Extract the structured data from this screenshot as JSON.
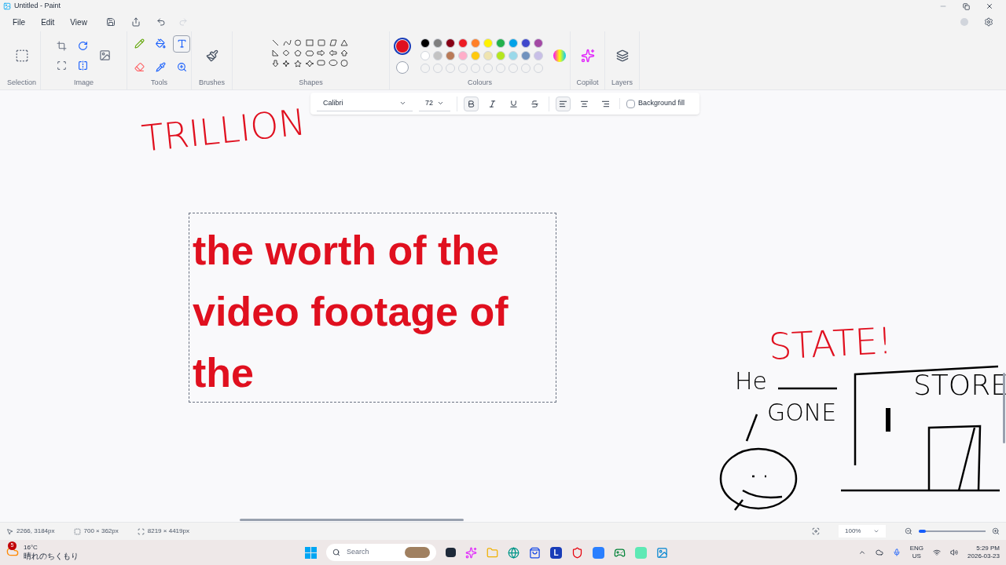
{
  "window": {
    "title": "Untitled - Paint"
  },
  "menu": [
    "File",
    "Edit",
    "View"
  ],
  "ribbon": {
    "groups": [
      {
        "kind": "selection",
        "label": "Selection"
      },
      {
        "kind": "image",
        "label": "Image"
      },
      {
        "kind": "tools",
        "label": "Tools"
      },
      {
        "kind": "brushes",
        "label": "Brushes"
      },
      {
        "kind": "shapes",
        "label": "Shapes"
      },
      {
        "kind": "colours",
        "label": "Colours"
      },
      {
        "kind": "copilot",
        "label": "Copilot"
      },
      {
        "kind": "layers",
        "label": "Layers"
      }
    ],
    "tools": [
      {
        "kind": "pencil",
        "selected": false
      },
      {
        "kind": "fill",
        "selected": false
      },
      {
        "kind": "text",
        "selected": true
      },
      {
        "kind": "eraser",
        "selected": false
      },
      {
        "kind": "picker",
        "selected": false
      },
      {
        "kind": "magnifier",
        "selected": false
      }
    ],
    "colour_1": {
      "color": "#e0101f"
    },
    "colour_2": {
      "color": "#ffffff"
    },
    "palette": [
      {
        "color": "#000000"
      },
      {
        "color": "#7f7f7f"
      },
      {
        "color": "#880015"
      },
      {
        "color": "#ed1c24"
      },
      {
        "color": "#ff7f27"
      },
      {
        "color": "#fff200"
      },
      {
        "color": "#22b14c"
      },
      {
        "color": "#00a2e8"
      },
      {
        "color": "#3f48cc"
      },
      {
        "color": "#a349a4"
      },
      {
        "color": "#ffffff"
      },
      {
        "color": "#c3c3c3"
      },
      {
        "color": "#b97a57"
      },
      {
        "color": "#ffaec9"
      },
      {
        "color": "#ffc90e"
      },
      {
        "color": "#efe4b0"
      },
      {
        "color": "#b5e61d"
      },
      {
        "color": "#99d9ea"
      },
      {
        "color": "#7092be"
      },
      {
        "color": "#c8bfe7"
      }
    ]
  },
  "text_toolbar": {
    "font": "Calibri",
    "size": "72",
    "styles": [
      {
        "kind": "bold",
        "selected": true
      },
      {
        "kind": "italic",
        "selected": false
      },
      {
        "kind": "underline",
        "selected": false
      },
      {
        "kind": "strikethrough",
        "selected": false
      }
    ],
    "align": [
      {
        "kind": "left",
        "selected": true
      },
      {
        "kind": "center",
        "selected": false
      },
      {
        "kind": "right",
        "selected": false
      }
    ],
    "background_fill": {
      "label": "Background fill",
      "checked": false
    }
  },
  "canvas": {
    "text_box": {
      "lines": [
        "the worth of the",
        "video footage of",
        "the"
      ],
      "color": "#e0101f"
    },
    "handwriting": [
      {
        "text": "TRILLION",
        "color": "#e0101f"
      },
      {
        "text": "STATE!",
        "color": "#e0101f"
      },
      {
        "text": "He",
        "color": "#000000"
      },
      {
        "text": "GONE",
        "color": "#000000"
      },
      {
        "text": "STORE",
        "color": "#000000"
      }
    ]
  },
  "status_bar": {
    "cursor": "2266, 3184px",
    "selection": "700 × 362px",
    "canvas_size": "8219 × 4419px",
    "zoom": "100%",
    "zoom_slider": {
      "level": 0.1
    }
  },
  "taskbar": {
    "weather": {
      "badge": "5",
      "temp": "16°C",
      "forecast": "晴れのちくもり"
    },
    "search": {
      "placeholder": "Search"
    },
    "app_letter": "L",
    "lang": "ENG",
    "region": "US",
    "time": "5:29 PM",
    "date": "2026-03-23"
  }
}
